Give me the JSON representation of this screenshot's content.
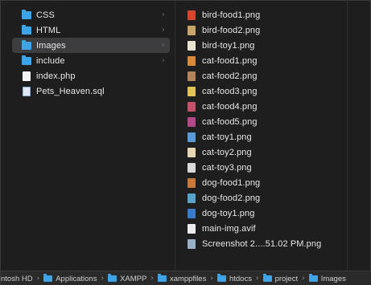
{
  "column1": {
    "items": [
      {
        "label": "CSS",
        "type": "folder",
        "chevron": "›",
        "selected": false
      },
      {
        "label": "HTML",
        "type": "folder",
        "chevron": "›",
        "selected": false
      },
      {
        "label": "Images",
        "type": "folder",
        "chevron": "›",
        "selected": true
      },
      {
        "label": "include",
        "type": "folder",
        "chevron": "›",
        "selected": false
      },
      {
        "label": "index.php",
        "type": "file"
      },
      {
        "label": "Pets_Heaven.sql",
        "type": "file"
      }
    ]
  },
  "column2": {
    "items": [
      {
        "label": "bird-food1.png",
        "thumb_color": "#d6452f"
      },
      {
        "label": "bird-food2.png",
        "thumb_color": "#c9a56b"
      },
      {
        "label": "bird-toy1.png",
        "thumb_color": "#e9e2d0"
      },
      {
        "label": "cat-food1.png",
        "thumb_color": "#d88a3a"
      },
      {
        "label": "cat-food2.png",
        "thumb_color": "#b5845a"
      },
      {
        "label": "cat-food3.png",
        "thumb_color": "#e0c45a"
      },
      {
        "label": "cat-food4.png",
        "thumb_color": "#c4506c"
      },
      {
        "label": "cat-food5.png",
        "thumb_color": "#b04a8a"
      },
      {
        "label": "cat-toy1.png",
        "thumb_color": "#5a9ad6"
      },
      {
        "label": "cat-toy2.png",
        "thumb_color": "#e8d7b5"
      },
      {
        "label": "cat-toy3.png",
        "thumb_color": "#d9d9d9"
      },
      {
        "label": "dog-food1.png",
        "thumb_color": "#c8783a"
      },
      {
        "label": "dog-food2.png",
        "thumb_color": "#5aa0c8"
      },
      {
        "label": "dog-toy1.png",
        "thumb_color": "#3a7ac8"
      },
      {
        "label": "main-img.avif",
        "thumb_color": "#ececec"
      },
      {
        "label": "Screenshot 2....51.02 PM.png",
        "thumb_color": "#9ab0c8"
      }
    ]
  },
  "pathbar": {
    "crumbs": [
      {
        "label": "ntosh HD",
        "icon": false
      },
      {
        "label": "Applications",
        "icon": true
      },
      {
        "label": "XAMPP",
        "icon": true
      },
      {
        "label": "xamppfiles",
        "icon": true
      },
      {
        "label": "htdocs",
        "icon": true
      },
      {
        "label": "project",
        "icon": true
      },
      {
        "label": "Images",
        "icon": true
      }
    ],
    "separator": "›"
  },
  "colors": {
    "folder": "#3fa3e8",
    "selection": "#3d3d3f",
    "background": "#1e1e1e"
  }
}
